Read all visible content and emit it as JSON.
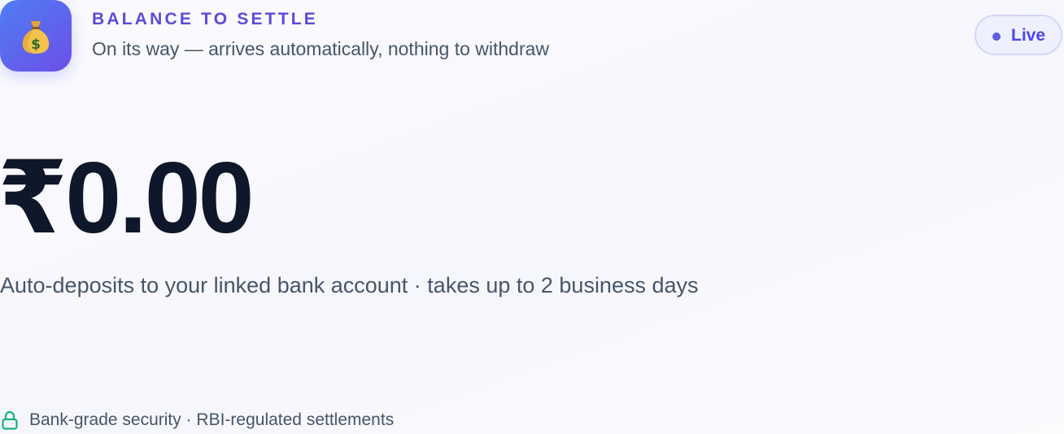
{
  "header": {
    "icon": "money-bag-icon",
    "eyebrow": "BALANCE TO SETTLE",
    "subtitle": "On its way — arrives automatically, nothing to withdraw"
  },
  "status_badge": {
    "label": "Live",
    "dot_color": "#5b5ee0"
  },
  "balance": {
    "amount": "₹0.00",
    "note": "Auto-deposits to your linked bank account · takes up to 2 business days"
  },
  "footer": {
    "icon": "lock-icon",
    "icon_color": "#16b37a",
    "text": "Bank-grade security · RBI-regulated settlements"
  },
  "colors": {
    "accent": "#5b4bd6",
    "icon_gradient_start": "#4f7df3",
    "icon_gradient_end": "#6c4fe8",
    "amount": "#0f172a",
    "muted_text": "#475569"
  }
}
